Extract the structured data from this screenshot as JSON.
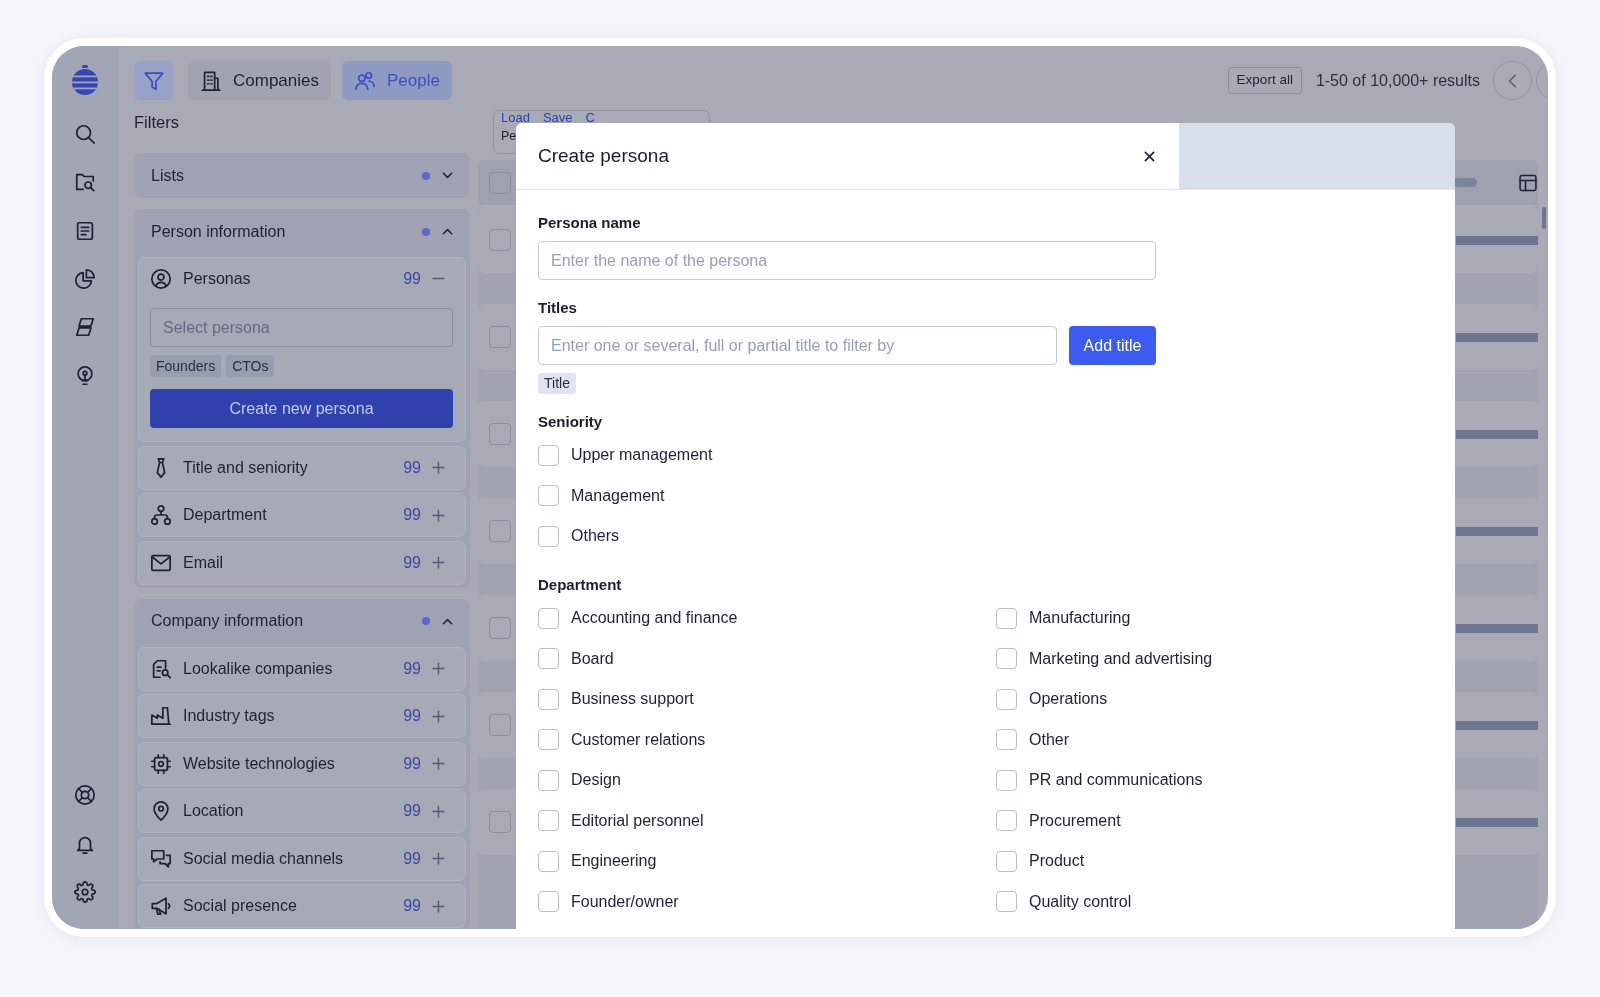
{
  "toolbar": {
    "filter_toggle": {
      "on": true
    },
    "tabs": [
      {
        "label": "Companies",
        "selected": false
      },
      {
        "label": "People",
        "selected": true
      }
    ],
    "export_button": "Export all",
    "results": "1-50 of 10,000+ results"
  },
  "filters": {
    "title": "Filters",
    "sections": [
      {
        "title": "Lists",
        "applied": true,
        "expanded": false
      },
      {
        "title": "Person information",
        "applied": true,
        "expanded": true,
        "items": [
          {
            "label": "Personas",
            "count": "99",
            "expanded": true,
            "placeholder": "Select persona",
            "tags": [
              "Founders",
              "CTOs"
            ],
            "button": "Create new persona"
          },
          {
            "label": "Title and seniority",
            "count": "99",
            "expanded": false
          },
          {
            "label": "Department",
            "count": "99",
            "expanded": false
          },
          {
            "label": "Email",
            "count": "99",
            "expanded": false
          }
        ]
      },
      {
        "title": "Company information",
        "applied": true,
        "expanded": true,
        "items": [
          {
            "label": "Lookalike companies",
            "count": "99",
            "expanded": false
          },
          {
            "label": "Industry tags",
            "count": "99",
            "expanded": false
          },
          {
            "label": "Website technologies",
            "count": "99",
            "expanded": false
          },
          {
            "label": "Location",
            "count": "99",
            "expanded": false
          },
          {
            "label": "Social media channels",
            "count": "99",
            "expanded": false
          },
          {
            "label": "Social presence",
            "count": "99",
            "expanded": false
          }
        ]
      }
    ]
  },
  "table": {
    "query_box": {
      "links": [
        "Load",
        "Save",
        "C"
      ],
      "text": "Pe"
    },
    "header_checked": false,
    "rows": [
      {
        "checked": false
      },
      {
        "checked": false
      },
      {
        "checked": false
      },
      {
        "checked": false
      },
      {
        "checked": false
      },
      {
        "checked": false
      },
      {
        "checked": false
      }
    ]
  },
  "modal": {
    "title": "Create persona",
    "persona_name": {
      "label": "Persona name",
      "placeholder": "Enter the name of the persona"
    },
    "titles": {
      "label": "Titles",
      "placeholder": "Enter one or several, full or partial title to filter by",
      "button": "Add title",
      "tags": [
        "Title"
      ]
    },
    "seniority": {
      "label": "Seniority",
      "options": [
        {
          "label": "Upper management",
          "checked": false
        },
        {
          "label": "Management",
          "checked": false
        },
        {
          "label": "Others",
          "checked": false
        }
      ]
    },
    "department": {
      "label": "Department",
      "options": [
        {
          "label": "Accounting and finance",
          "checked": false
        },
        {
          "label": "Board",
          "checked": false
        },
        {
          "label": "Business support",
          "checked": false
        },
        {
          "label": "Customer relations",
          "checked": false
        },
        {
          "label": "Design",
          "checked": false
        },
        {
          "label": "Editorial personnel",
          "checked": false
        },
        {
          "label": "Engineering",
          "checked": false
        },
        {
          "label": "Founder/owner",
          "checked": false
        },
        {
          "label": "Manufacturing",
          "checked": false
        },
        {
          "label": "Marketing and advertising",
          "checked": false
        },
        {
          "label": "Operations",
          "checked": false
        },
        {
          "label": "Other",
          "checked": false
        },
        {
          "label": "PR and communications",
          "checked": false
        },
        {
          "label": "Procurement",
          "checked": false
        },
        {
          "label": "Product",
          "checked": false
        },
        {
          "label": "Quality control",
          "checked": false
        }
      ]
    }
  }
}
